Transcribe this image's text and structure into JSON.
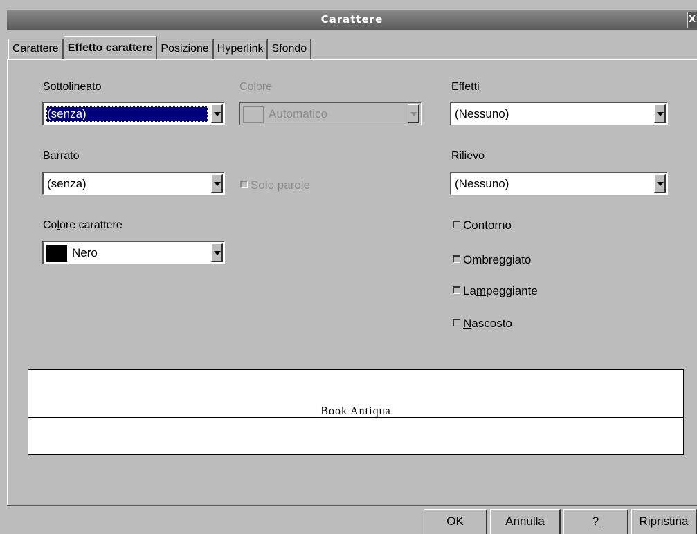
{
  "window": {
    "title": "Carattere",
    "close_glyph": "X"
  },
  "tabs": [
    {
      "label": "Carattere"
    },
    {
      "label": "Effetto carattere",
      "active": true
    },
    {
      "label": "Posizione"
    },
    {
      "label": "Hyperlink"
    },
    {
      "label": "Sfondo"
    }
  ],
  "underline": {
    "mnemonic": "S",
    "label_rest": "ottolineato",
    "value": "(senza)"
  },
  "color": {
    "mnemonic": "C",
    "label_rest": "olore",
    "value": "Automatico",
    "disabled": true
  },
  "effects": {
    "label_pre": "Effet",
    "mnemonic": "t",
    "label_post": "i",
    "value": "(Nessuno)"
  },
  "strikethrough": {
    "mnemonic": "B",
    "label_rest": "arrato",
    "value": "(senza)"
  },
  "words_only": {
    "label_pre": "Solo par",
    "mnemonic": "o",
    "label_post": "le",
    "disabled": true
  },
  "relief": {
    "mnemonic": "R",
    "label_rest": "ilievo",
    "value": "(Nessuno)"
  },
  "font_color": {
    "label_pre": "Co",
    "mnemonic": "l",
    "label_post": "ore carattere",
    "value": "Nero",
    "swatch_color": "#000000"
  },
  "checkboxes": {
    "outline": {
      "mnemonic": "C",
      "label_rest": "ontorno"
    },
    "shadow": {
      "label_pre": "Ombre",
      "mnemonic": "g",
      "label_post": "giato"
    },
    "blinking": {
      "label_pre": "La",
      "mnemonic": "m",
      "label_post": "peggiante"
    },
    "hidden": {
      "mnemonic": "N",
      "label_rest": "ascosto"
    }
  },
  "preview": {
    "text": "Book Antiqua"
  },
  "buttons": {
    "ok": "OK",
    "cancel": "Annulla",
    "help": "?",
    "reset_pre": "Ri",
    "reset_mnemonic": "p",
    "reset_post": "ristina"
  },
  "colors": {
    "selection": "#00007c",
    "background": "#bcbcbc",
    "disabled_text": "#8c8c8c"
  }
}
